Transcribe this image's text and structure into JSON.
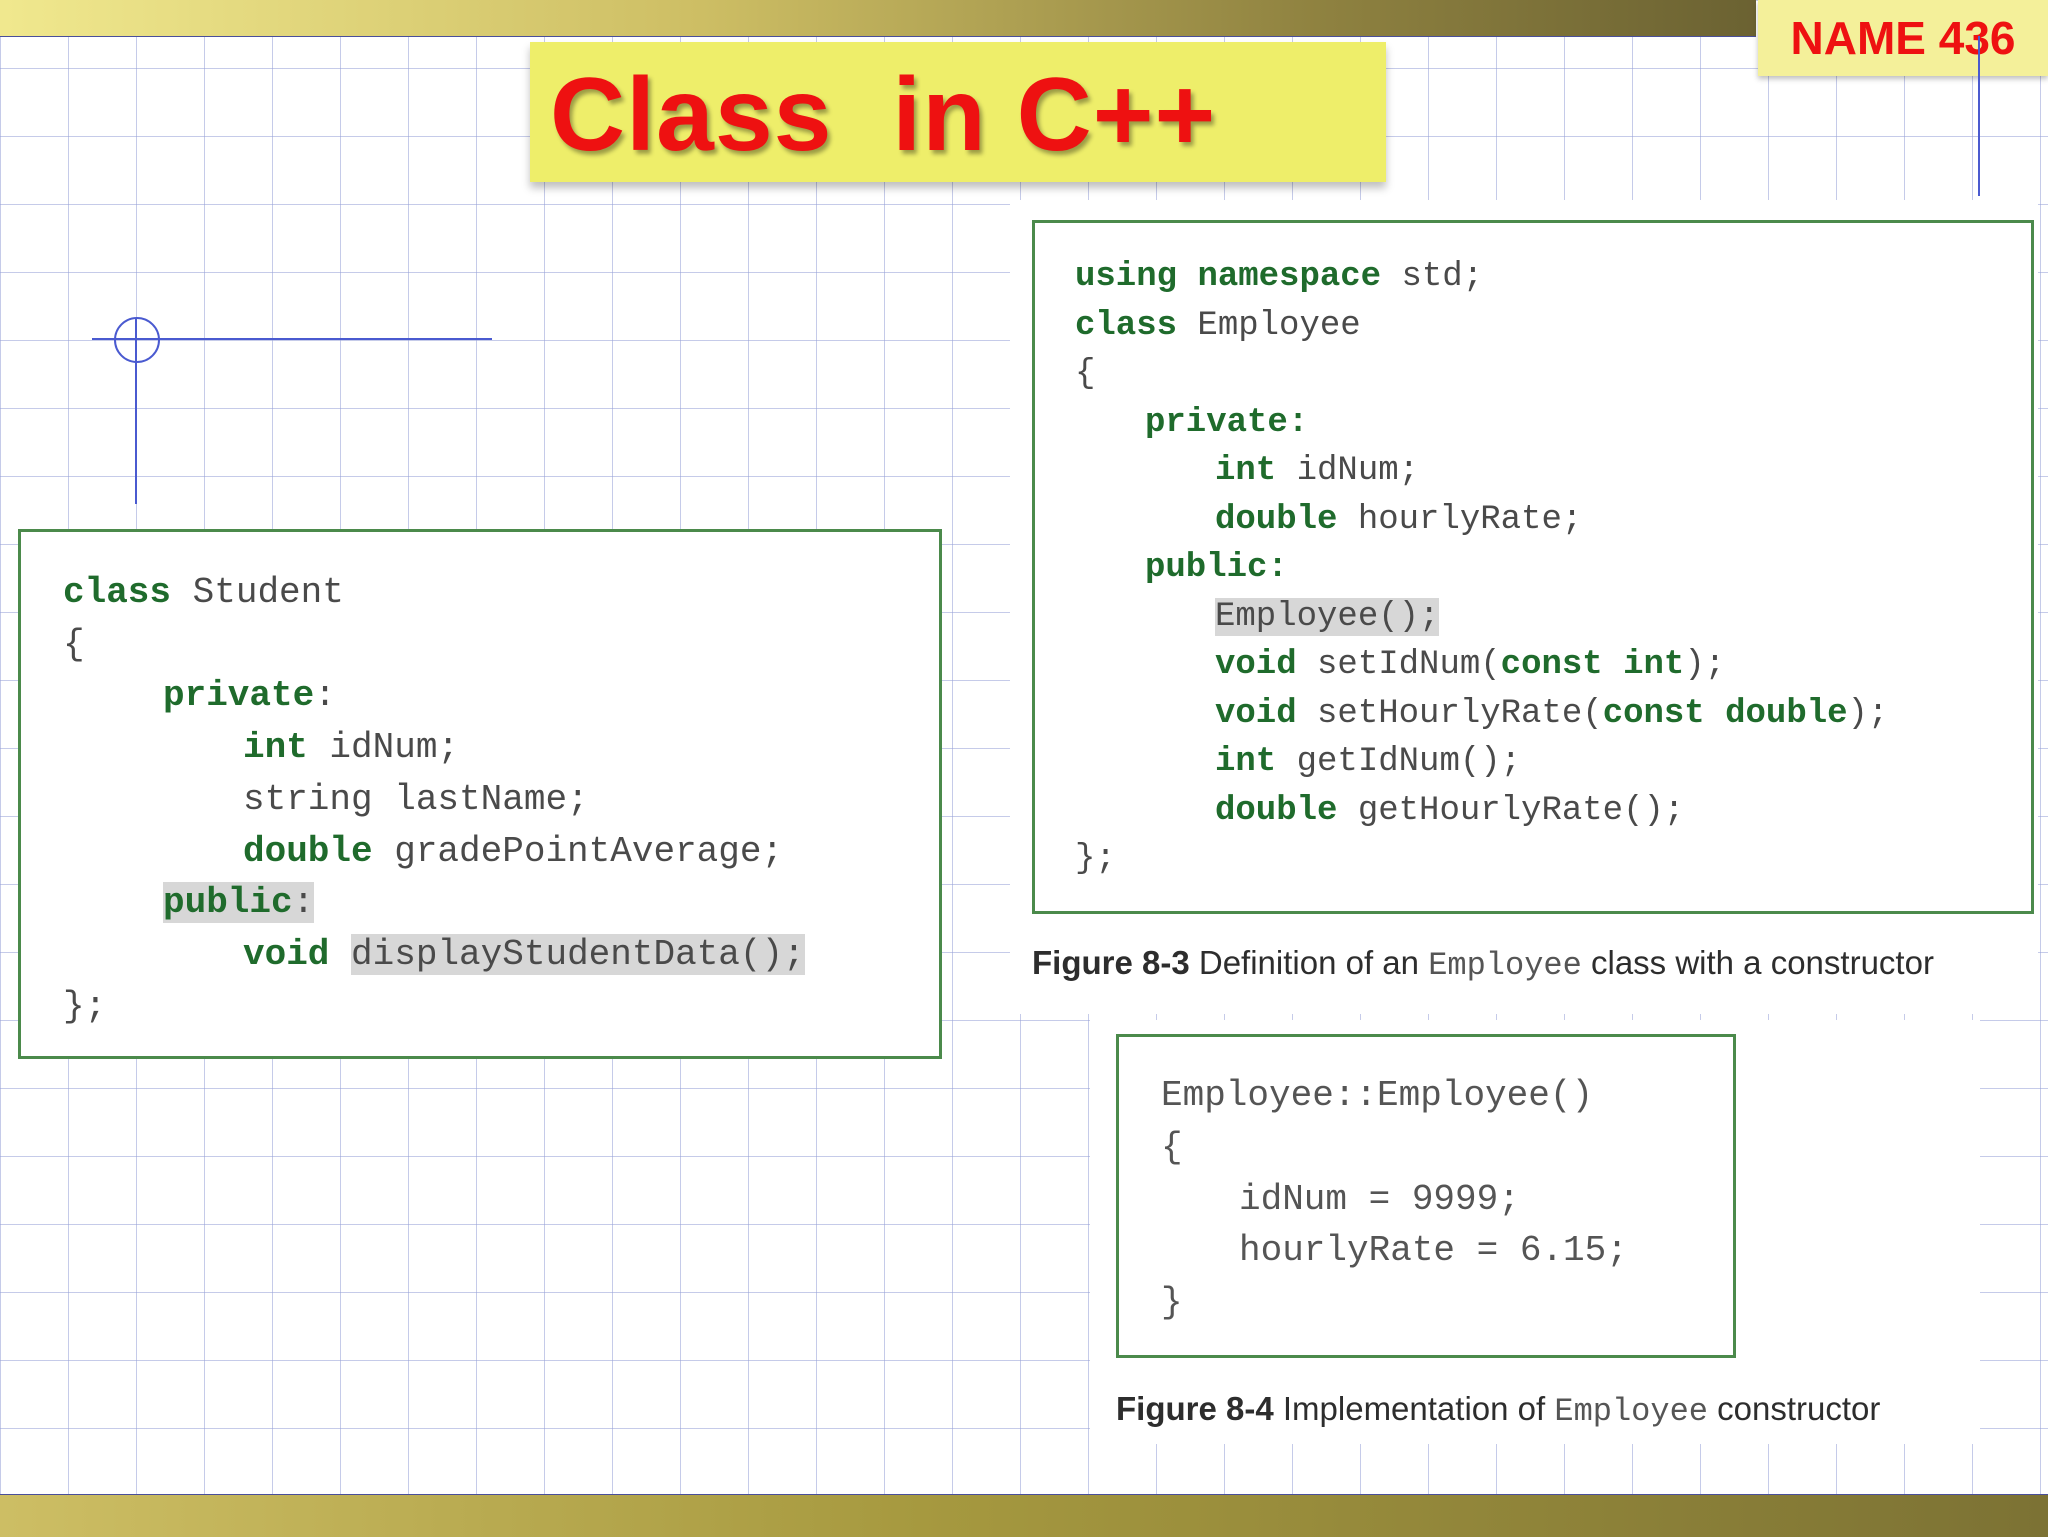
{
  "header": {
    "name_badge": "NAME 436",
    "title": "Class  in C++"
  },
  "student_code": {
    "lines": {
      "l1": {
        "kw": "class",
        "text": " Student"
      },
      "l2": {
        "text": "{"
      },
      "l3": {
        "kw": "private",
        "text": ":"
      },
      "l4": {
        "kw": "int",
        "text": " idNum;"
      },
      "l5": {
        "text": "string lastName;"
      },
      "l6": {
        "kw": "double",
        "text": " gradePointAverage;"
      },
      "l7": {
        "kw": "public",
        "text": ":"
      },
      "l8": {
        "kw": "void",
        "hl": "displayStudentData();"
      },
      "l9": {
        "text": "};"
      }
    }
  },
  "employee_code": {
    "lines": {
      "l1": {
        "kw1": "using",
        "kw2": "namespace",
        "text": " std;"
      },
      "l2": {
        "kw": "class",
        "text": " Employee"
      },
      "l3": {
        "text": "{"
      },
      "l4": {
        "kw": "private",
        "text": ":"
      },
      "l5": {
        "kw": "int",
        "text": " idNum;"
      },
      "l6": {
        "kw": "double",
        "text": " hourlyRate;"
      },
      "l7": {
        "kw": "public",
        "text": ":"
      },
      "l8": {
        "hl": "Employee();"
      },
      "l9": {
        "kw": "void",
        "text": " setIdNum(",
        "kw2": "const int",
        "text2": ");"
      },
      "l10": {
        "kw": "void",
        "text": " setHourlyRate(",
        "kw2": "const double",
        "text2": ");"
      },
      "l11": {
        "kw": "int",
        "text": " getIdNum();"
      },
      "l12": {
        "kw": "double",
        "text": " getHourlyRate();"
      },
      "l13": {
        "text": "};"
      }
    }
  },
  "figure_8_3": {
    "label": "Figure 8-3",
    "text1": " Definition of an ",
    "code": "Employee",
    "text2": " class with a constructor"
  },
  "constructor_code": {
    "lines": {
      "l1": {
        "text": "Employee::Employee()"
      },
      "l2": {
        "text": "{"
      },
      "l3": {
        "text": "idNum = 9999;"
      },
      "l4": {
        "text": "hourlyRate = 6.15;"
      },
      "l5": {
        "text": "}"
      }
    }
  },
  "figure_8_4": {
    "label": "Figure 8-4",
    "text1": " Implementation of ",
    "code": "Employee",
    "text2": " constructor"
  },
  "colors": {
    "keyword": "#1f6b2c",
    "title": "#ee1111",
    "border": "#4b8a4b",
    "badge_bg": "#f4f09a",
    "title_bg": "#eeee6a"
  }
}
